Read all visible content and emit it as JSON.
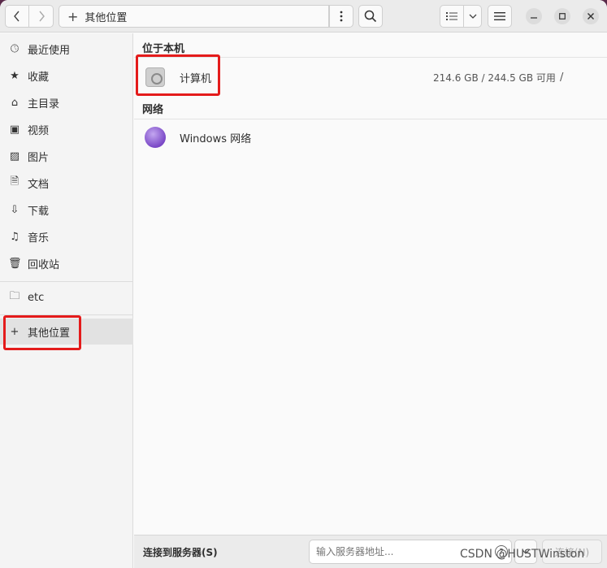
{
  "header": {
    "back_icon": "chevron-left-icon",
    "forward_icon": "chevron-right-icon",
    "path_icon": "plus-icon",
    "path_label": "其他位置",
    "path_menu_icon": "vertical-dots-icon",
    "search_icon": "search-icon",
    "view_icon": "list-view-icon",
    "view_dropdown_icon": "chevron-down-icon",
    "menu_icon": "hamburger-menu-icon",
    "minimize_icon": "minimize-icon",
    "maximize_icon": "maximize-icon",
    "close_icon": "close-icon"
  },
  "sidebar": {
    "items": [
      {
        "label": "最近使用",
        "icon": "clock-icon"
      },
      {
        "label": "收藏",
        "icon": "star-icon"
      },
      {
        "label": "主目录",
        "icon": "home-icon"
      },
      {
        "label": "视频",
        "icon": "video-icon"
      },
      {
        "label": "图片",
        "icon": "image-icon"
      },
      {
        "label": "文档",
        "icon": "document-icon"
      },
      {
        "label": "下载",
        "icon": "download-icon"
      },
      {
        "label": "音乐",
        "icon": "music-icon"
      },
      {
        "label": "回收站",
        "icon": "trash-icon"
      }
    ],
    "bookmarks": [
      {
        "label": "etc",
        "icon": "folder-icon"
      }
    ],
    "other_locations": {
      "label": "其他位置",
      "icon": "plus-icon"
    }
  },
  "main": {
    "section_local": "位于本机",
    "computer": {
      "label": "计算机",
      "info": "214.6 GB / 244.5 GB 可用",
      "path": "/",
      "icon": "hard-disk-icon"
    },
    "section_network": "网络",
    "network": {
      "label": "Windows 网络",
      "icon": "network-globe-icon"
    }
  },
  "footer": {
    "label": "连接到服务器(S)",
    "input_placeholder": "输入服务器地址...",
    "help_icon": "help-icon",
    "dropdown_icon": "chevron-down-icon",
    "connect_label": "连接(N)"
  },
  "watermark": "CSDN @HUSTWinston",
  "colors": {
    "highlight": "#e41b1b",
    "network_globe": "#7a48c6"
  }
}
